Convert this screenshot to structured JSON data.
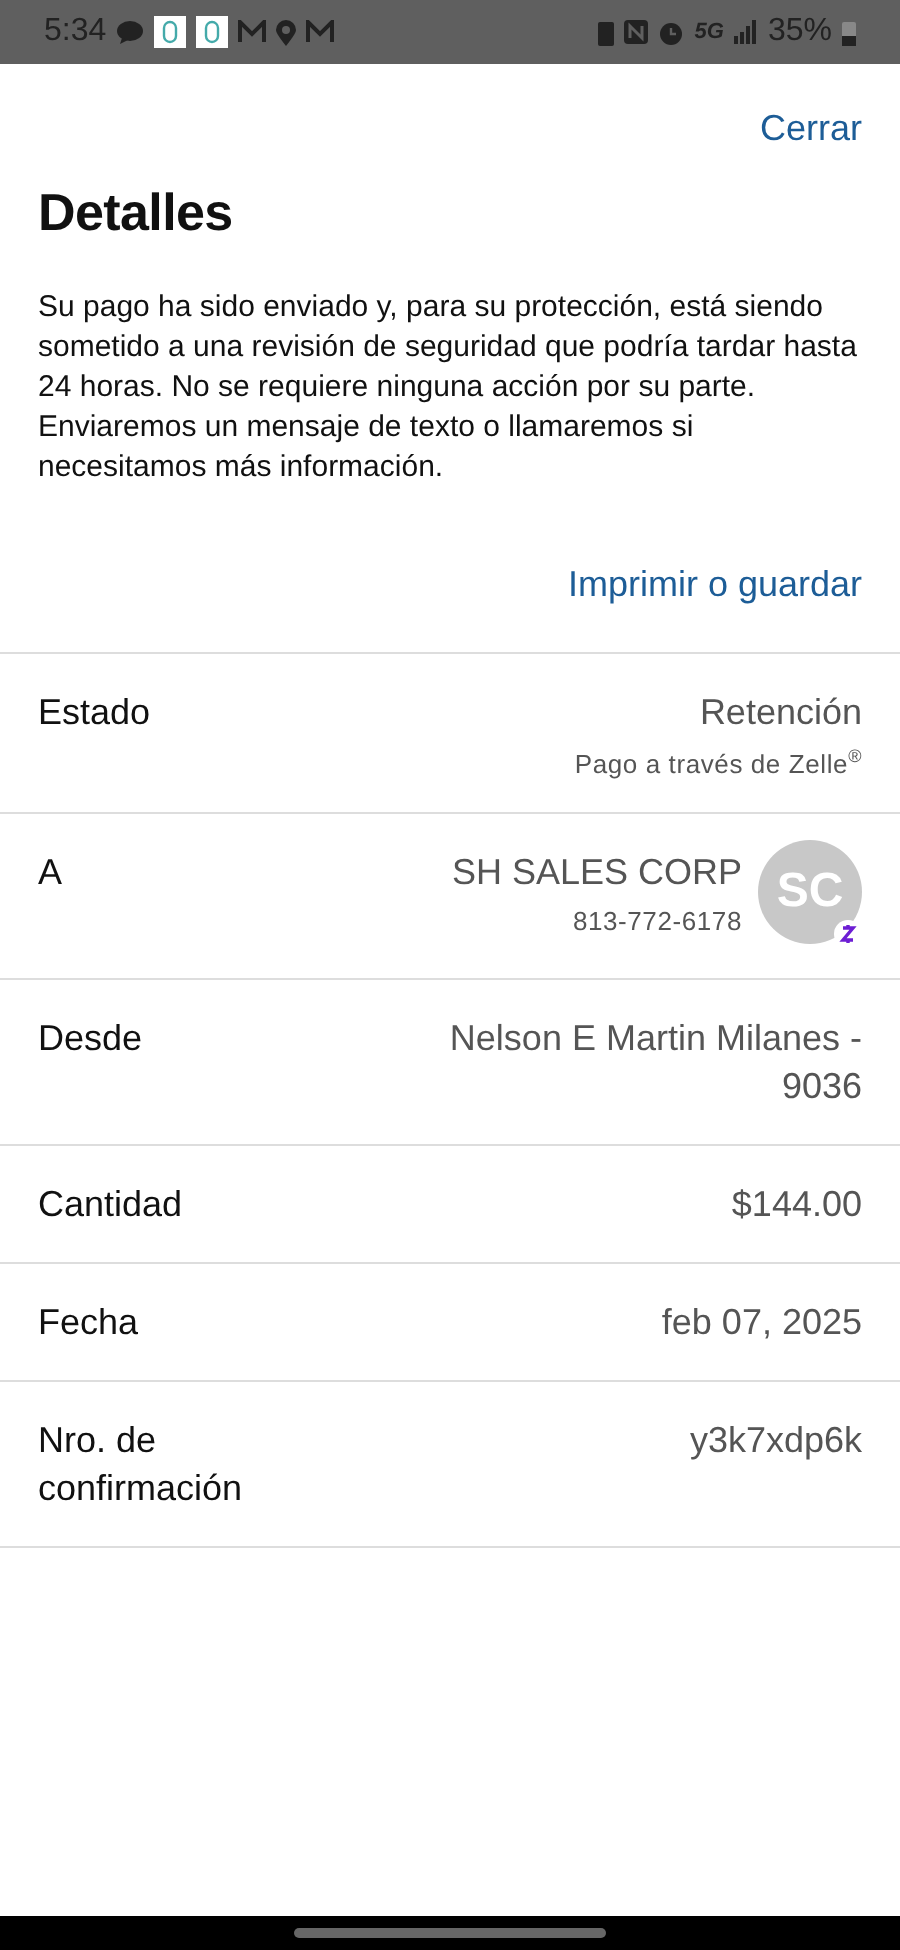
{
  "status_bar": {
    "time": "5:34",
    "network": "5G",
    "battery": "35%"
  },
  "close_link": "Cerrar",
  "title": "Detalles",
  "message": "Su pago ha sido enviado y, para su protección, está siendo sometido a una revisión de seguridad que podría tardar hasta 24 horas. No se requiere ninguna acción por su parte. Enviaremos un mensaje de texto o llamaremos si necesitamos más información.",
  "print_link": "Imprimir o guardar",
  "details": [
    {
      "kind": "status",
      "label": "Estado",
      "value": "Retención",
      "note": "Pago a través de Zelle$^{®}$"
    },
    {
      "kind": "payee",
      "label": "A",
      "value": "SH SALES CORP",
      "note": "813-772-6178",
      "initials": "SC"
    },
    {
      "kind": "plain",
      "label": "Desde",
      "value": "Nelson E Martin Milanes - 9036"
    },
    {
      "kind": "plain",
      "label": "Cantidad",
      "value": "$144.00"
    },
    {
      "kind": "plain",
      "label": "Fecha",
      "value": "feb 07, 2025"
    },
    {
      "kind": "plain",
      "label": "Nro. de confirmación",
      "value": "y3k7xdp6k"
    }
  ]
}
